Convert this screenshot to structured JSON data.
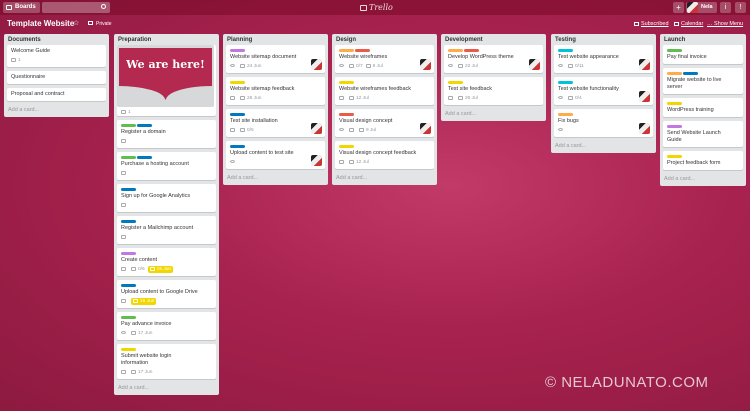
{
  "topbar": {
    "boards_label": "Boards",
    "search_value": "",
    "logo_text": "Trello",
    "add_glyph": "+",
    "user_name": "Nela",
    "info_glyph": "i",
    "bell_glyph": "!"
  },
  "boardbar": {
    "title": "Template Website",
    "star_glyph": "☆",
    "privacy": "Private",
    "subscribed": "Subscribed",
    "calendar": "Calendar",
    "show_menu": "Show Menu",
    "menu_glyph": "…"
  },
  "colors": {
    "green": "#61bd4f",
    "blue": "#0079bf",
    "purple": "#c377e0",
    "orange": "#ffab4a",
    "red": "#eb5a46",
    "yellow": "#f2d600",
    "sky": "#00c2e0"
  },
  "add_card": "Add a card...",
  "lists": [
    {
      "name": "Documents",
      "cards": [
        {
          "title": "Welcome Guide",
          "labels": [],
          "badges": [
            {
              "type": "comments",
              "text": "1"
            }
          ],
          "member": false
        },
        {
          "title": "Questionnaire",
          "labels": [],
          "badges": [],
          "member": false
        },
        {
          "title": "Proposal and contract",
          "labels": [],
          "badges": [],
          "member": false
        }
      ]
    },
    {
      "name": "Preparation",
      "banner_text": "We are here!",
      "cards": [
        {
          "banner": true,
          "title": "",
          "labels": [],
          "badges": [
            {
              "type": "comments",
              "text": "1"
            }
          ],
          "member": false
        },
        {
          "title": "Register a domain",
          "labels": [
            "green",
            "blue"
          ],
          "badges": [
            {
              "type": "desc",
              "text": ""
            }
          ],
          "member": false
        },
        {
          "title": "Purchase a hosting account",
          "labels": [
            "green",
            "blue"
          ],
          "badges": [
            {
              "type": "desc",
              "text": ""
            }
          ],
          "member": false
        },
        {
          "title": "Sign up for Google Analytics",
          "labels": [
            "blue"
          ],
          "badges": [
            {
              "type": "desc",
              "text": ""
            }
          ],
          "member": false
        },
        {
          "title": "Register a Mailchimp account",
          "labels": [
            "blue"
          ],
          "badges": [
            {
              "type": "desc",
              "text": ""
            }
          ],
          "member": false
        },
        {
          "title": "Create content",
          "labels": [
            "purple"
          ],
          "badges": [
            {
              "type": "desc",
              "text": ""
            },
            {
              "type": "checklist",
              "text": "0/6"
            },
            {
              "type": "due-soon",
              "text": "15 Jun"
            }
          ],
          "member": false
        },
        {
          "title": "Upload content to Google Drive",
          "labels": [
            "blue"
          ],
          "badges": [
            {
              "type": "desc",
              "text": ""
            },
            {
              "type": "due-soon",
              "text": "15 Jun"
            }
          ],
          "member": false
        },
        {
          "title": "Pay advance invoice",
          "labels": [
            "green"
          ],
          "badges": [
            {
              "type": "watch",
              "text": ""
            },
            {
              "type": "due",
              "text": "17 Jun"
            }
          ],
          "member": false
        },
        {
          "title": "Submit website login information",
          "labels": [
            "yellow"
          ],
          "badges": [
            {
              "type": "desc",
              "text": ""
            },
            {
              "type": "due",
              "text": "17 Jun"
            }
          ],
          "member": false
        }
      ]
    },
    {
      "name": "Planning",
      "cards": [
        {
          "title": "Website sitemap document",
          "labels": [
            "purple"
          ],
          "badges": [
            {
              "type": "watch",
              "text": ""
            },
            {
              "type": "due",
              "text": "24 Jun"
            }
          ],
          "member": true
        },
        {
          "title": "Website sitemap feedback",
          "labels": [
            "yellow"
          ],
          "badges": [
            {
              "type": "desc",
              "text": ""
            },
            {
              "type": "due",
              "text": "28 Jun"
            }
          ],
          "member": false
        },
        {
          "title": "Test site installation",
          "labels": [
            "blue"
          ],
          "badges": [
            {
              "type": "desc",
              "text": ""
            },
            {
              "type": "checklist",
              "text": "0/5"
            }
          ],
          "member": true
        },
        {
          "title": "Upload content to test site",
          "labels": [
            "blue"
          ],
          "badges": [
            {
              "type": "watch",
              "text": ""
            }
          ],
          "member": true
        }
      ]
    },
    {
      "name": "Design",
      "cards": [
        {
          "title": "Website wireframes",
          "labels": [
            "orange",
            "red"
          ],
          "badges": [
            {
              "type": "watch",
              "text": ""
            },
            {
              "type": "checklist",
              "text": "0/7"
            },
            {
              "type": "due",
              "text": "8 Jul"
            }
          ],
          "member": true
        },
        {
          "title": "Website wireframes feedback",
          "labels": [
            "yellow"
          ],
          "badges": [
            {
              "type": "desc",
              "text": ""
            },
            {
              "type": "due",
              "text": "12 Jul"
            }
          ],
          "member": false
        },
        {
          "title": "Visual design concept",
          "labels": [
            "red"
          ],
          "badges": [
            {
              "type": "watch",
              "text": ""
            },
            {
              "type": "checklist",
              "text": ""
            },
            {
              "type": "due",
              "text": "9 Jul"
            }
          ],
          "member": true
        },
        {
          "title": "Visual design concept feedback",
          "labels": [
            "yellow"
          ],
          "badges": [
            {
              "type": "desc",
              "text": ""
            },
            {
              "type": "due",
              "text": "12 Jul"
            }
          ],
          "member": false
        }
      ]
    },
    {
      "name": "Development",
      "cards": [
        {
          "title": "Develop WordPress theme",
          "labels": [
            "orange",
            "red"
          ],
          "badges": [
            {
              "type": "watch",
              "text": ""
            },
            {
              "type": "due",
              "text": "22 Jul"
            }
          ],
          "member": true
        },
        {
          "title": "Test site feedback",
          "labels": [
            "yellow"
          ],
          "badges": [
            {
              "type": "desc",
              "text": ""
            },
            {
              "type": "due",
              "text": "26 Jul"
            }
          ],
          "member": false
        }
      ]
    },
    {
      "name": "Testing",
      "cards": [
        {
          "title": "Test website appearance",
          "labels": [
            "sky"
          ],
          "badges": [
            {
              "type": "watch",
              "text": ""
            },
            {
              "type": "checklist",
              "text": "0/11"
            }
          ],
          "member": true
        },
        {
          "title": "Test website functionality",
          "labels": [
            "sky"
          ],
          "badges": [
            {
              "type": "watch",
              "text": ""
            },
            {
              "type": "checklist",
              "text": "0/4"
            }
          ],
          "member": true
        },
        {
          "title": "Fix bugs",
          "labels": [
            "orange"
          ],
          "badges": [
            {
              "type": "watch",
              "text": ""
            }
          ],
          "member": true
        }
      ]
    },
    {
      "name": "Launch",
      "cards": [
        {
          "title": "Pay final invoice",
          "labels": [
            "green"
          ],
          "badges": [],
          "member": false
        },
        {
          "title": "Migrate website to live server",
          "labels": [
            "orange",
            "blue"
          ],
          "badges": [],
          "member": false
        },
        {
          "title": "WordPress training",
          "labels": [
            "yellow"
          ],
          "badges": [],
          "member": false
        },
        {
          "title": "Send Website Launch Guide",
          "labels": [
            "purple"
          ],
          "badges": [],
          "member": false
        },
        {
          "title": "Project feedback form",
          "labels": [
            "yellow"
          ],
          "badges": [],
          "member": false
        }
      ]
    }
  ],
  "watermark": "© NELADUNATO.COM"
}
